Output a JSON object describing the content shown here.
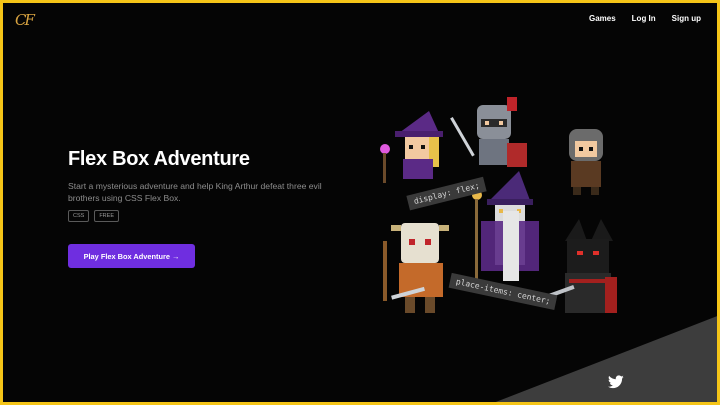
{
  "header": {
    "logo_text": "CF",
    "nav": {
      "games": "Games",
      "login": "Log In",
      "signup": "Sign up"
    }
  },
  "hero": {
    "title": "Flex Box Adventure",
    "description": "Start a mysterious adventure and help King Arthur defeat three evil brothers using CSS Flex Box.",
    "tags": [
      "CSS",
      "FREE"
    ],
    "cta_label": "Play Flex Box Adventure →"
  },
  "art": {
    "code_label_1": "display: flex;",
    "code_label_2": "place-items: center;"
  },
  "colors": {
    "frame": "#f5c518",
    "background": "#050505",
    "accent": "#6f2ee0",
    "corner": "#3d3d3d"
  },
  "icons": {
    "social": "twitter-icon"
  }
}
